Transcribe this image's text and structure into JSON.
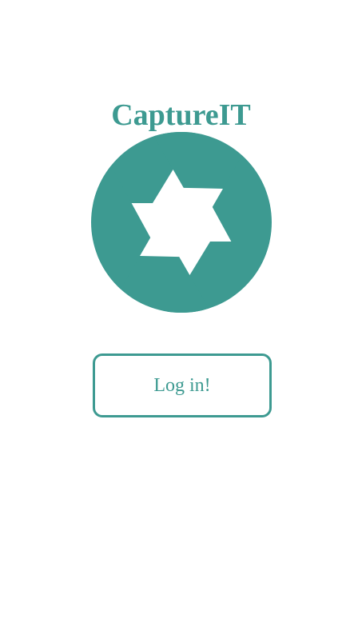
{
  "app": {
    "title": "CaptureIT",
    "brand_color": "#3d9a91"
  },
  "logo": {
    "icon": "camera-aperture-icon"
  },
  "login": {
    "button_label": "Log in!"
  }
}
